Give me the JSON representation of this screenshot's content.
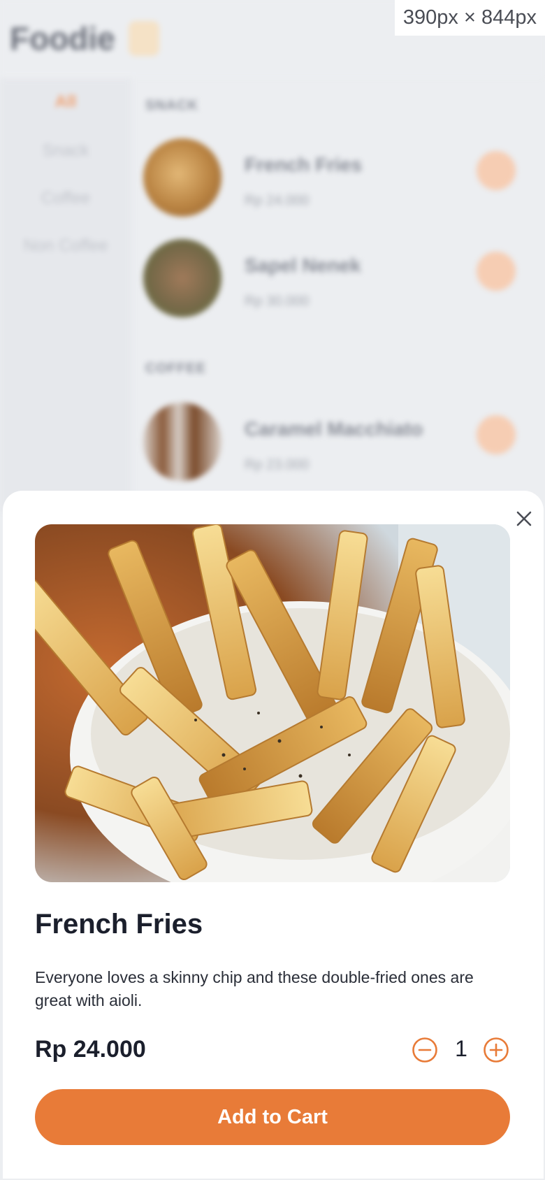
{
  "app": {
    "logo_text": "Foodie",
    "viewport_label": "390px × 844px"
  },
  "background_menu": {
    "categories": [
      "All",
      "Snack",
      "Coffee",
      "Non Coffee"
    ],
    "active_category": "All",
    "sections": [
      {
        "title": "SNACK",
        "items": [
          {
            "name": "French Fries",
            "price": "Rp 24.000"
          },
          {
            "name": "Sapel Nenek",
            "price": "Rp 30.000"
          }
        ]
      },
      {
        "title": "COFFEE",
        "items": [
          {
            "name": "Caramel Macchiato",
            "price": "Rp 23.000"
          }
        ]
      }
    ]
  },
  "sheet": {
    "close_icon": "close-icon",
    "image_alt": "French fries in a white bowl",
    "name": "French Fries",
    "description": "Everyone loves a skinny chip and these double-fried ones are great with aioli.",
    "price": "Rp 24.000",
    "quantity": "1",
    "minus_icon": "minus-circle-icon",
    "plus_icon": "plus-circle-icon",
    "add_to_cart_label": "Add to Cart"
  },
  "colors": {
    "accent": "#e87b38",
    "background": "#eceef1",
    "sheet": "#ffffff",
    "text_dark": "#1b1f2c"
  }
}
